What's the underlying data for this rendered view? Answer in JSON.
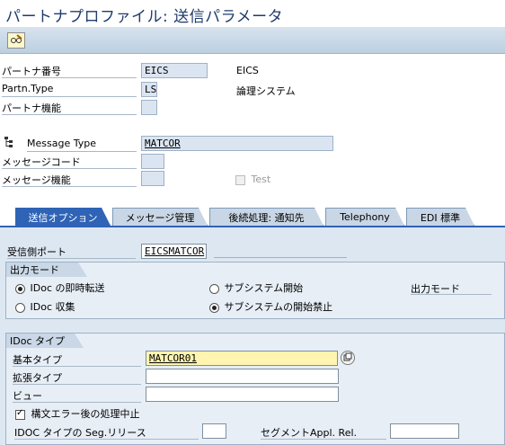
{
  "window": {
    "title": "パートナプロファイル: 送信パラメータ"
  },
  "toolbar": {
    "edit_icon": "pencil-glasses-icon"
  },
  "header": {
    "partner_number_label": "パートナ番号",
    "partner_number_value": "EICS",
    "partner_number_desc": "EICS",
    "partner_type_label": "Partn.Type",
    "partner_type_value": "LS",
    "partner_type_desc": "論理システム",
    "partner_function_label": "パートナ機能",
    "partner_function_value": ""
  },
  "message": {
    "type_label": "Message Type",
    "type_value": "MATCOR",
    "code_label": "メッセージコード",
    "code_value": "",
    "function_label": "メッセージ機能",
    "function_value": "",
    "test_label": "Test",
    "test_checked": false
  },
  "tabs": [
    {
      "label": "送信オプション",
      "active": true
    },
    {
      "label": "メッセージ管理",
      "active": false
    },
    {
      "label": "後続処理: 通知先",
      "active": false
    },
    {
      "label": "Telephony",
      "active": false
    },
    {
      "label": "EDI 標準",
      "active": false
    }
  ],
  "receiver_port": {
    "label": "受信側ポート",
    "value": "EICSMATCOR"
  },
  "output_mode": {
    "title": "出力モード",
    "immediate_label": "IDoc の即時転送",
    "immediate_selected": true,
    "collect_label": "IDoc 収集",
    "collect_selected": false,
    "start_subsystem_label": "サブシステム開始",
    "start_subsystem_selected": false,
    "no_start_subsystem_label": "サブシステムの開始禁止",
    "no_start_subsystem_selected": true,
    "output_mode_label": "出力モード"
  },
  "idoc_type": {
    "title": "IDoc タイプ",
    "basic_type_label": "基本タイプ",
    "basic_type_value": "MATCOR01",
    "extension_label": "拡張タイプ",
    "extension_value": "",
    "view_label": "ビュー",
    "view_value": "",
    "cancel_on_syntax_error_label": "構文エラー後の処理中止",
    "cancel_on_syntax_error_checked": true,
    "seg_release_label": "IDOC タイプの Seg.リリース",
    "seg_release_value": "",
    "segment_appl_rel_label": "セグメントAppl. Rel.",
    "segment_appl_rel_value": ""
  }
}
